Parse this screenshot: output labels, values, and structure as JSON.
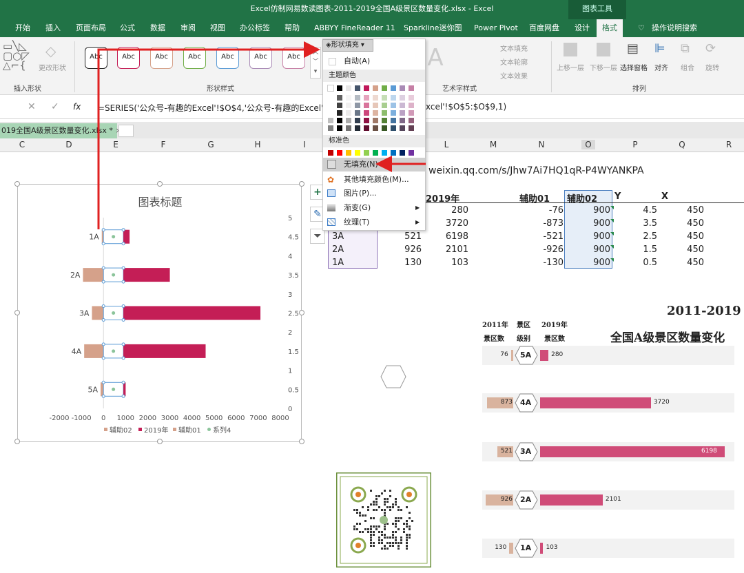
{
  "window": {
    "title": "Excel仿制网易数读图表-2011-2019全国A级景区数量变化.xlsx  -  Excel",
    "context_tab": "图表工具"
  },
  "ribbon_tabs": [
    "开始",
    "插入",
    "页面布局",
    "公式",
    "数据",
    "审阅",
    "视图",
    "办公标签",
    "帮助",
    "ABBYY FineReader 11",
    "Sparkline迷你图",
    "Power Pivot",
    "百度网盘",
    "设计",
    "格式",
    "操作说明搜索"
  ],
  "ribbon": {
    "insert_shapes": "插入形状",
    "change_shape": "更改形状",
    "shape_styles": "形状样式",
    "style_sample": "Abc",
    "fill_button": "形状填充",
    "wordart_styles": "艺术字样式",
    "text_fill": "文本填充",
    "text_outline": "文本轮廓",
    "text_effect": "文本效果",
    "arrange": "排列",
    "bring_forward": "上移一层",
    "send_backward": "下移一层",
    "selection_pane": "选择窗格",
    "align": "对齐",
    "group": "组合",
    "rotate": "旋转"
  },
  "formula": {
    "fx": "fx",
    "text": "=SERIES('公众号-有趣的Excel'!$O$4,'公众号-有趣的Excel'!",
    "text2": "xcel'!$O$5:$O$9,1)"
  },
  "workbook_tab": "019全国A级景区数量变化.xlsx *",
  "columns": [
    "C",
    "D",
    "E",
    "F",
    "G",
    "H",
    "I",
    "L",
    "M",
    "N",
    "O",
    "P",
    "Q",
    "R"
  ],
  "url_text": "weixin.qq.com/s/Jhw7Ai7HQ1qR-P4WYANKPA",
  "table": {
    "headers": {
      "y2019": "2019年",
      "aux01": "辅助01",
      "aux02": "辅助02",
      "y": "Y",
      "x": "X"
    },
    "rows": [
      {
        "label": "",
        "y2011": "",
        "y2019": "280",
        "aux01": "-76",
        "aux02": "900",
        "y": "4.5",
        "x": "450"
      },
      {
        "label": "",
        "y2011": "",
        "y2019": "3720",
        "aux01": "-873",
        "aux02": "900",
        "y": "3.5",
        "x": "450"
      },
      {
        "label": "3A",
        "y2011": "521",
        "y2019": "6198",
        "aux01": "-521",
        "aux02": "900",
        "y": "2.5",
        "x": "450"
      },
      {
        "label": "2A",
        "y2011": "926",
        "y2019": "2101",
        "aux01": "-926",
        "aux02": "900",
        "y": "1.5",
        "x": "450"
      },
      {
        "label": "1A",
        "y2011": "130",
        "y2019": "103",
        "aux01": "-130",
        "aux02": "900",
        "y": "0.5",
        "x": "450"
      }
    ]
  },
  "menu": {
    "header": "形状填充",
    "auto": "自动(A)",
    "theme_colors": "主题颜色",
    "standard_colors": "标准色",
    "no_fill": "无填充(N)",
    "more_colors": "其他填充颜色(M)...",
    "picture": "图片(P)...",
    "gradient": "渐变(G)",
    "texture": "纹理(T)",
    "theme_top": [
      "#ffffff",
      "#000000",
      "#e7e6e6",
      "#44546a",
      "#c0185a",
      "#d5a18a",
      "#70ad47",
      "#5b9bd5",
      "#a98ab5",
      "#c67fa5"
    ],
    "standard": [
      "#c00000",
      "#ff0000",
      "#ffc000",
      "#ffff00",
      "#92d050",
      "#00b050",
      "#00b0f0",
      "#0070c0",
      "#002060",
      "#7030a0"
    ]
  },
  "chart_data": {
    "type": "bar",
    "title": "图表标题",
    "categories": [
      "1A",
      "2A",
      "3A",
      "4A",
      "5A"
    ],
    "series": [
      {
        "name": "辅助02",
        "values": [
          -76,
          -926,
          -521,
          -873,
          -130
        ]
      },
      {
        "name": "2019年",
        "values": [
          280,
          2101,
          6198,
          3720,
          103
        ]
      },
      {
        "name": "辅助01",
        "values": [
          -76,
          -926,
          -521,
          -873,
          -130
        ]
      },
      {
        "name": "系列4",
        "values": [
          450,
          450,
          450,
          450,
          450
        ]
      }
    ],
    "x_ticks": [
      "-2000",
      "-1000",
      "0",
      "1000",
      "2000",
      "3000",
      "4000",
      "5000",
      "6000",
      "7000",
      "8000"
    ],
    "y2_ticks": [
      "5",
      "4.5",
      "4",
      "3.5",
      "3",
      "2.5",
      "2",
      "1.5",
      "1",
      "0.5",
      "0"
    ],
    "xlim": [
      -2000,
      8000
    ],
    "colors": {
      "2019": "#c41e56",
      "aux": "#d5a18a",
      "dot": "#8bc49a"
    }
  },
  "infographic": {
    "title1": "2011-2019",
    "title2": "全国A级景区数量变化",
    "h2011a": "2011年",
    "h2011b": "景区数",
    "hlvl_a": "景区",
    "hlvl_b": "级别",
    "h2019a": "2019年",
    "h2019b": "景区数",
    "rows": [
      {
        "lvl": "5A",
        "v2011": "76",
        "v2019": "280"
      },
      {
        "lvl": "4A",
        "v2011": "873",
        "v2019": "3720"
      },
      {
        "lvl": "3A",
        "v2011": "521",
        "v2019": "6198"
      },
      {
        "lvl": "2A",
        "v2011": "926",
        "v2019": "2101"
      },
      {
        "lvl": "1A",
        "v2011": "130",
        "v2019": "103"
      }
    ]
  }
}
